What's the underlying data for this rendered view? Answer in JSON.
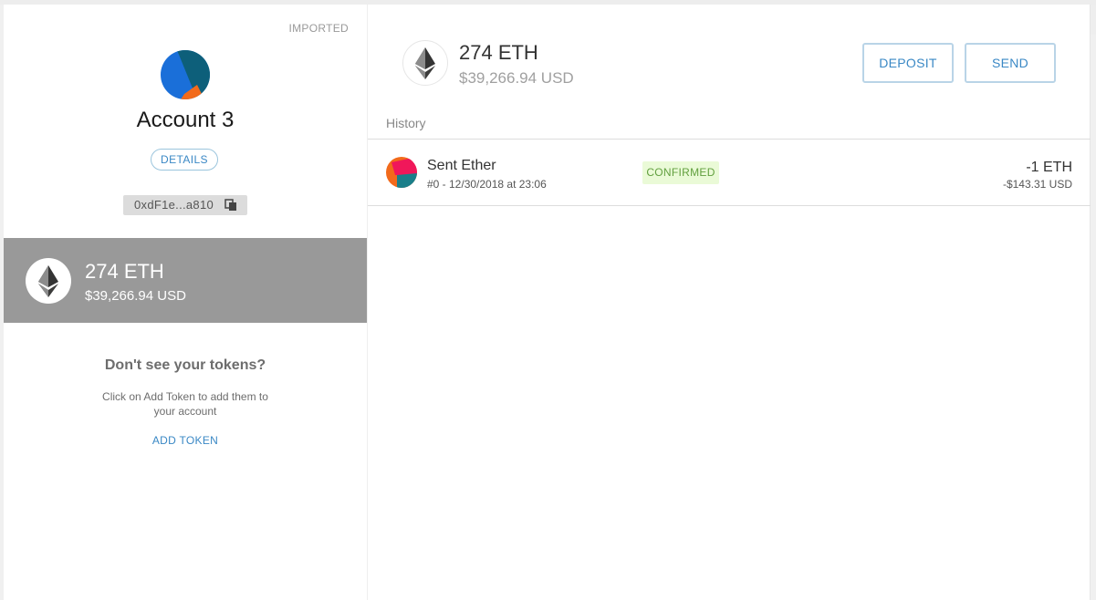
{
  "sidebar": {
    "account_type_label": "IMPORTED",
    "account_name": "Account 3",
    "details_label": "DETAILS",
    "address_short": "0xdF1e...a810",
    "tokens": [
      {
        "amount": "274 ETH",
        "usd": "$39,266.94 USD",
        "icon": "ethereum-icon"
      }
    ],
    "no_tokens_title": "Don't see your tokens?",
    "no_tokens_desc": "Click on Add Token to add them to your account",
    "add_token_label": "ADD TOKEN"
  },
  "balance": {
    "amount": "274 ETH",
    "usd": "$39,266.94 USD",
    "icon": "ethereum-icon"
  },
  "actions": {
    "deposit_label": "DEPOSIT",
    "send_label": "SEND"
  },
  "history": {
    "label": "History",
    "transactions": [
      {
        "title": "Sent Ether",
        "subtitle": "#0 - 12/30/2018 at 23:06",
        "status": "CONFIRMED",
        "amount": "-1 ETH",
        "amount_usd": "-$143.31 USD"
      }
    ]
  },
  "colors": {
    "accent": "#3a88c5",
    "selected_token_bg": "#999999",
    "confirmed_bg": "#eafad7",
    "confirmed_text": "#62a03f"
  }
}
